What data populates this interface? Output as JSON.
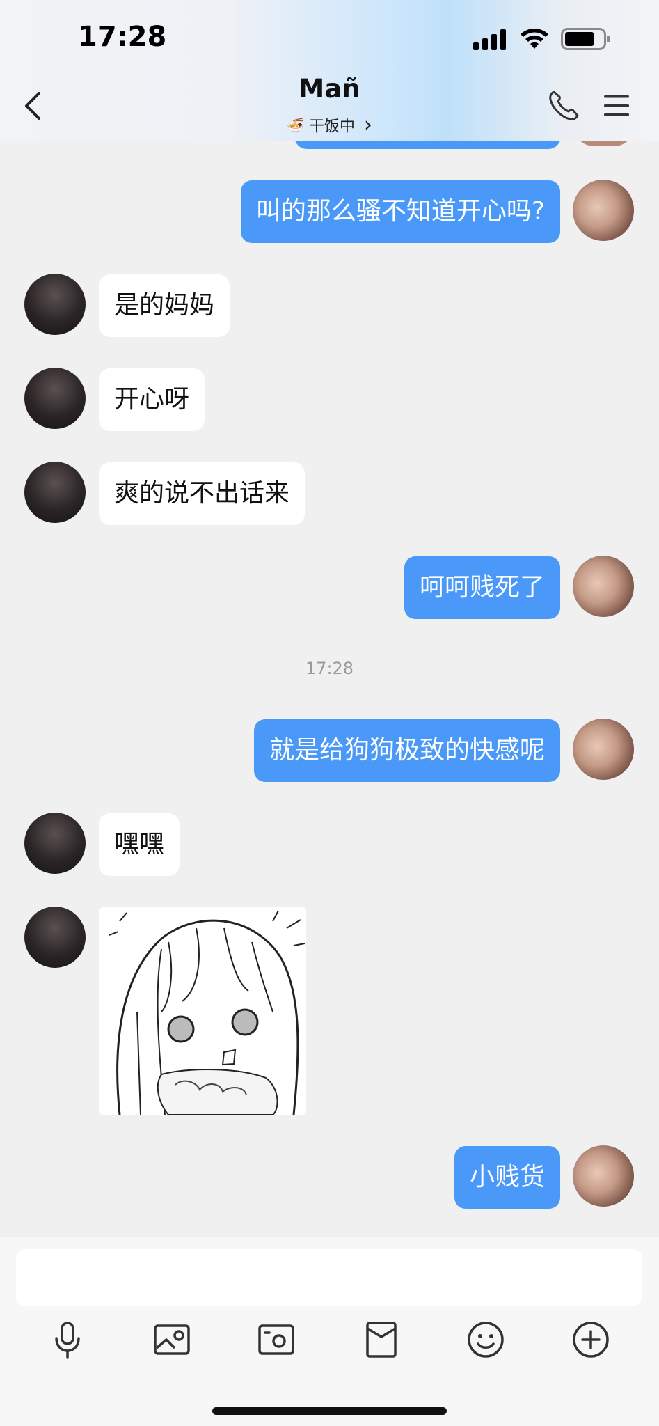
{
  "status_bar": {
    "time": "17:28"
  },
  "header": {
    "title": "Mañ",
    "status_emoji": "🍜",
    "status_text": "干饭中",
    "status_chevron": "›"
  },
  "messages": [
    {
      "side": "right",
      "text": "叫的那么骚不知道开心吗?"
    },
    {
      "side": "left",
      "text": "是的妈妈"
    },
    {
      "side": "left",
      "text": "开心呀"
    },
    {
      "side": "left",
      "text": "爽的说不出话来"
    },
    {
      "side": "right",
      "text": "呵呵贱死了"
    },
    {
      "side": "right",
      "text": "就是给狗狗极致的快感呢"
    },
    {
      "side": "left",
      "text": "嘿嘿"
    },
    {
      "side": "left",
      "type": "sticker",
      "text": ""
    },
    {
      "side": "right",
      "text": "小贱货"
    }
  ],
  "timestamp": "17:28",
  "toolbar_icons": [
    "microphone-icon",
    "image-icon",
    "camera-icon",
    "red-packet-icon",
    "emoji-icon",
    "plus-icon"
  ],
  "colors": {
    "accent": "#4a98f7",
    "background": "#f0f0f0",
    "bubble_left": "#ffffff"
  }
}
